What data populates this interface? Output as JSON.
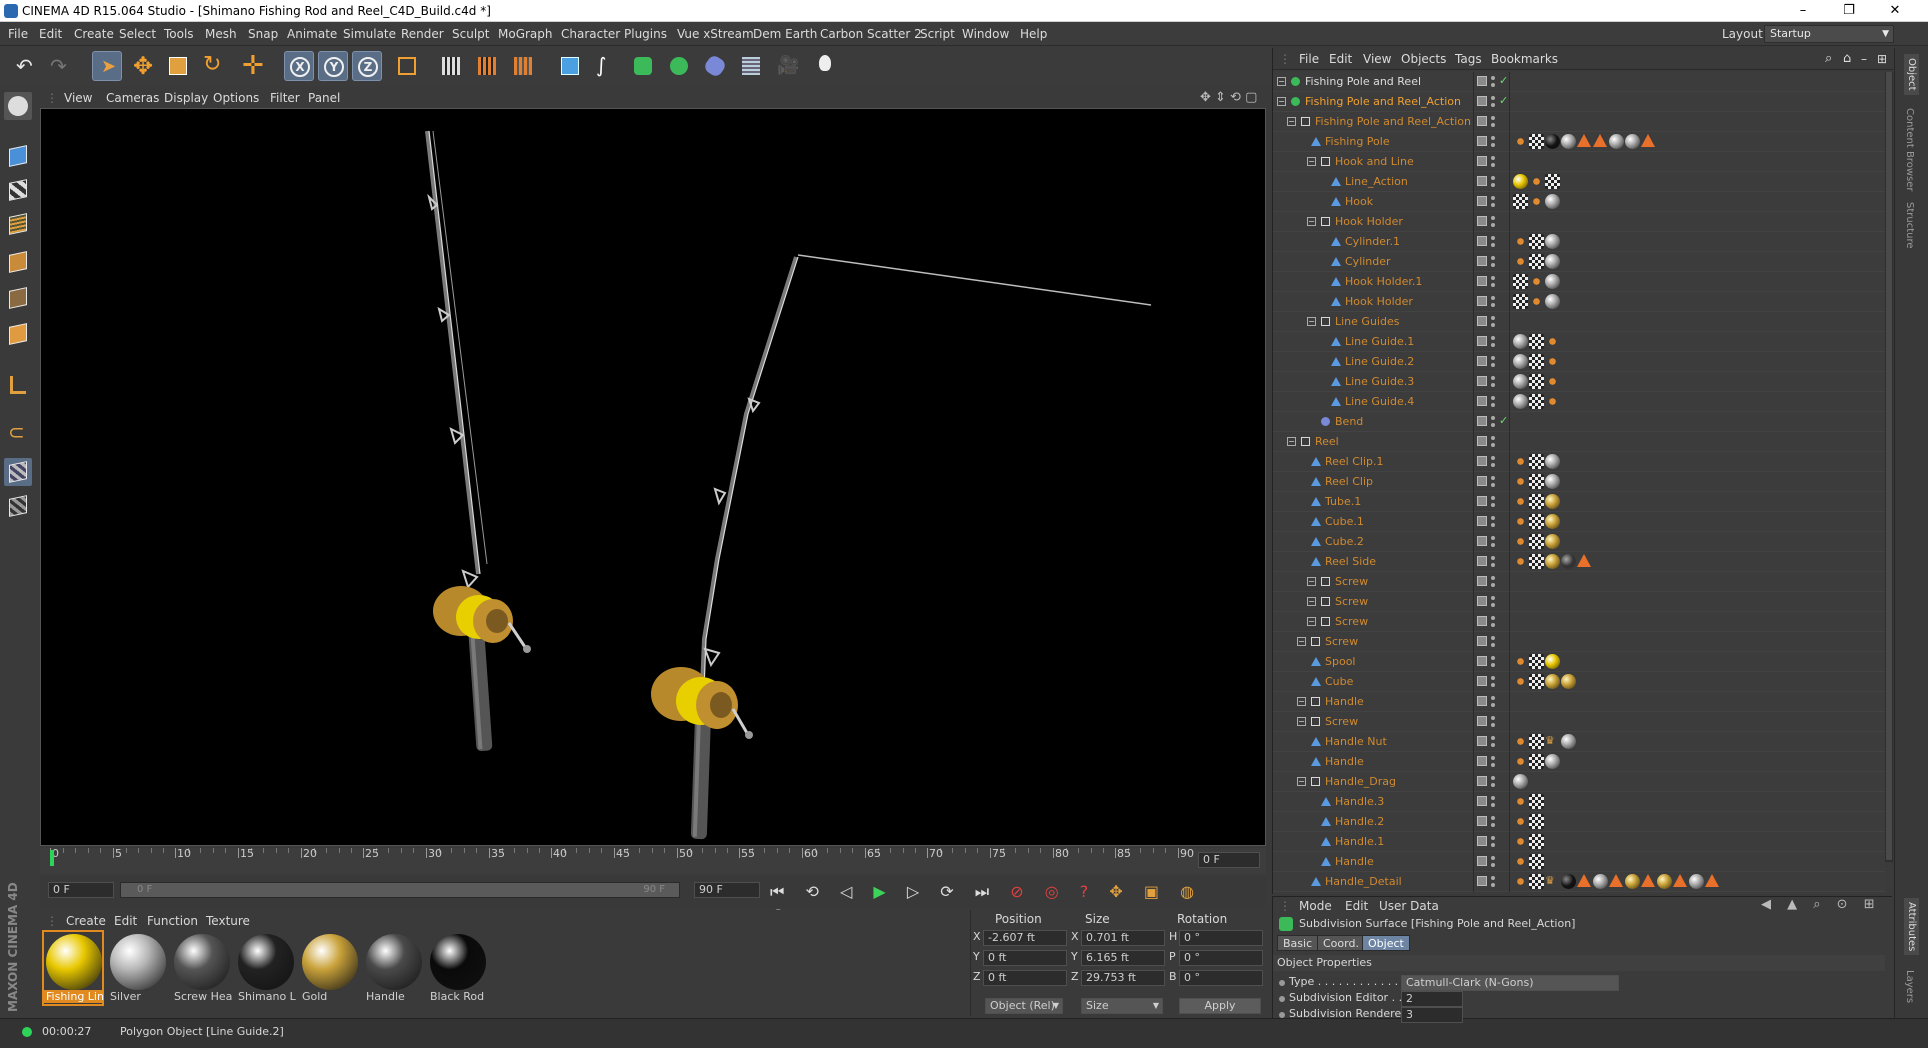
{
  "window": {
    "title": "CINEMA 4D R15.064 Studio - [Shimano Fishing Rod and Reel_C4D_Build.c4d *]",
    "controls": [
      "–",
      "❐",
      "✕"
    ]
  },
  "menubar": {
    "items": [
      "File",
      "Edit",
      "Create",
      "Select",
      "Tools",
      "Mesh",
      "Snap",
      "Animate",
      "Simulate",
      "Render",
      "Sculpt",
      "MoGraph",
      "Character",
      "Plugins",
      "Vue xStream",
      "Dem Earth",
      "Carbon Scatter 2",
      "Script",
      "Window",
      "Help"
    ],
    "layout_label": "Layout:",
    "layout_value": "Startup"
  },
  "toolbar": {
    "axis_x": "X",
    "axis_y": "Y",
    "axis_z": "Z"
  },
  "viewport": {
    "menu": [
      "View",
      "Cameras",
      "Display",
      "Options",
      "Filter",
      "Panel"
    ]
  },
  "timeline": {
    "ticks": [
      "0",
      "5",
      "10",
      "15",
      "20",
      "25",
      "30",
      "35",
      "40",
      "45",
      "50",
      "55",
      "60",
      "65",
      "70",
      "75",
      "80",
      "85",
      "90"
    ],
    "current_frame": "0 F",
    "start_field": "0 F",
    "range_start": "0 F",
    "range_end": "90 F",
    "end_field": "90 F"
  },
  "materials": {
    "menu": [
      "Create",
      "Edit",
      "Function",
      "Texture"
    ],
    "items": [
      {
        "name": "Fishing Lin",
        "color": "#e8c800"
      },
      {
        "name": "Silver",
        "color": "#b8b8b8"
      },
      {
        "name": "Screw Head",
        "color": "#555555"
      },
      {
        "name": "Shimano Lo",
        "color": "#222222"
      },
      {
        "name": "Gold",
        "color": "#c9a23a"
      },
      {
        "name": "Handle",
        "color": "#4a4a4a"
      },
      {
        "name": "Black Rod",
        "color": "#0a0a0a"
      }
    ]
  },
  "coordinates": {
    "headers": [
      "Position",
      "Size",
      "Rotation"
    ],
    "rows": [
      {
        "axis": "X",
        "pos": "-2.607 ft",
        "size_axis": "X",
        "size": "0.701 ft",
        "rot_axis": "H",
        "rot": "0 °"
      },
      {
        "axis": "Y",
        "pos": "0 ft",
        "size_axis": "Y",
        "size": "6.165 ft",
        "rot_axis": "P",
        "rot": "0 °"
      },
      {
        "axis": "Z",
        "pos": "0 ft",
        "size_axis": "Z",
        "size": "29.753 ft",
        "rot_axis": "B",
        "rot": "0 °"
      }
    ],
    "mode": "Object (Rel)",
    "size_mode": "Size",
    "apply": "Apply"
  },
  "status": {
    "time": "00:00:27",
    "message": "Polygon Object [Line Guide.2]"
  },
  "object_manager": {
    "menu": [
      "File",
      "Edit",
      "View",
      "Objects",
      "Tags",
      "Bookmarks"
    ],
    "rows": [
      {
        "name": "Fishing Pole and Reel",
        "depth": 0,
        "color": "#dcdcdc",
        "icon": "sds",
        "check": true
      },
      {
        "name": "Fishing Pole and Reel_Action",
        "depth": 0,
        "color": "#f0a030",
        "icon": "sds",
        "check": true
      },
      {
        "name": "Fishing Pole and Reel_Action",
        "depth": 1,
        "color": "#d08a30",
        "icon": "null"
      },
      {
        "name": "Fishing Pole",
        "depth": 2,
        "color": "#d08a30",
        "icon": "poly",
        "tags": [
          "phong",
          "check",
          "black",
          "silver",
          "tri",
          "tri",
          "silver",
          "silver",
          "tri"
        ]
      },
      {
        "name": "Hook and Line",
        "depth": 3,
        "color": "#d08a30",
        "icon": "null"
      },
      {
        "name": "Line_Action",
        "depth": 4,
        "color": "#d08a30",
        "icon": "poly",
        "tags": [
          "yellow",
          "phong",
          "check"
        ]
      },
      {
        "name": "Hook",
        "depth": 4,
        "color": "#d08a30",
        "icon": "poly",
        "tags": [
          "check",
          "phong",
          "silver"
        ]
      },
      {
        "name": "Hook Holder",
        "depth": 3,
        "color": "#d08a30",
        "icon": "null"
      },
      {
        "name": "Cylinder.1",
        "depth": 4,
        "color": "#d08a30",
        "icon": "poly",
        "tags": [
          "phong",
          "check",
          "silver"
        ]
      },
      {
        "name": "Cylinder",
        "depth": 4,
        "color": "#d08a30",
        "icon": "poly",
        "tags": [
          "phong",
          "check",
          "silver"
        ]
      },
      {
        "name": "Hook Holder.1",
        "depth": 4,
        "color": "#d08a30",
        "icon": "poly",
        "tags": [
          "check",
          "phong",
          "silver"
        ]
      },
      {
        "name": "Hook Holder",
        "depth": 4,
        "color": "#d08a30",
        "icon": "poly",
        "tags": [
          "check",
          "phong",
          "silver"
        ]
      },
      {
        "name": "Line Guides",
        "depth": 3,
        "color": "#d08a30",
        "icon": "null"
      },
      {
        "name": "Line Guide.1",
        "depth": 4,
        "color": "#d08a30",
        "icon": "poly",
        "tags": [
          "silver",
          "check",
          "phong"
        ]
      },
      {
        "name": "Line Guide.2",
        "depth": 4,
        "color": "#d08a30",
        "icon": "poly",
        "tags": [
          "silver",
          "check",
          "phong"
        ]
      },
      {
        "name": "Line Guide.3",
        "depth": 4,
        "color": "#d08a30",
        "icon": "poly",
        "tags": [
          "silver",
          "check",
          "phong"
        ]
      },
      {
        "name": "Line Guide.4",
        "depth": 4,
        "color": "#d08a30",
        "icon": "poly",
        "tags": [
          "silver",
          "check",
          "phong"
        ]
      },
      {
        "name": "Bend",
        "depth": 3,
        "color": "#d08a30",
        "icon": "deform",
        "check": true
      },
      {
        "name": "Reel",
        "depth": 1,
        "color": "#d08a30",
        "icon": "null"
      },
      {
        "name": "Reel Clip.1",
        "depth": 2,
        "color": "#d08a30",
        "icon": "poly",
        "tags": [
          "phong",
          "check",
          "silver"
        ]
      },
      {
        "name": "Reel Clip",
        "depth": 2,
        "color": "#d08a30",
        "icon": "poly",
        "tags": [
          "phong",
          "check",
          "silver"
        ]
      },
      {
        "name": "Tube.1",
        "depth": 2,
        "color": "#d08a30",
        "icon": "poly",
        "tags": [
          "phong",
          "check",
          "gold"
        ]
      },
      {
        "name": "Cube.1",
        "depth": 2,
        "color": "#d08a30",
        "icon": "poly",
        "tags": [
          "phong",
          "check",
          "gold"
        ]
      },
      {
        "name": "Cube.2",
        "depth": 2,
        "color": "#d08a30",
        "icon": "poly",
        "tags": [
          "phong",
          "check",
          "gold"
        ]
      },
      {
        "name": "Reel Side",
        "depth": 2,
        "color": "#d08a30",
        "icon": "poly",
        "tags": [
          "phong",
          "check",
          "gold",
          "dark",
          "tri"
        ]
      },
      {
        "name": "Screw",
        "depth": 3,
        "color": "#d08a30",
        "icon": "null"
      },
      {
        "name": "Screw",
        "depth": 3,
        "color": "#d08a30",
        "icon": "null"
      },
      {
        "name": "Screw",
        "depth": 3,
        "color": "#d08a30",
        "icon": "null"
      },
      {
        "name": "Screw",
        "depth": 2,
        "color": "#d08a30",
        "icon": "null"
      },
      {
        "name": "Spool",
        "depth": 2,
        "color": "#d08a30",
        "icon": "poly",
        "tags": [
          "phong",
          "check",
          "yellow"
        ]
      },
      {
        "name": "Cube",
        "depth": 2,
        "color": "#d08a30",
        "icon": "poly",
        "tags": [
          "phong",
          "check",
          "gold",
          "gold"
        ]
      },
      {
        "name": "Handle",
        "depth": 2,
        "color": "#d08a30",
        "icon": "null"
      },
      {
        "name": "Screw",
        "depth": 2,
        "color": "#d08a30",
        "icon": "null"
      },
      {
        "name": "Handle Nut",
        "depth": 2,
        "color": "#d08a30",
        "icon": "poly",
        "tags": [
          "phong",
          "check",
          "crown",
          "silver"
        ]
      },
      {
        "name": "Handle",
        "depth": 2,
        "color": "#d08a30",
        "icon": "poly",
        "tags": [
          "phong",
          "check",
          "silver"
        ]
      },
      {
        "name": "Handle_Drag",
        "depth": 2,
        "color": "#d08a30",
        "icon": "null",
        "tags": [
          "silver"
        ]
      },
      {
        "name": "Handle.3",
        "depth": 3,
        "color": "#d08a30",
        "icon": "poly",
        "tags": [
          "phong",
          "check"
        ]
      },
      {
        "name": "Handle.2",
        "depth": 3,
        "color": "#d08a30",
        "icon": "poly",
        "tags": [
          "phong",
          "check"
        ]
      },
      {
        "name": "Handle.1",
        "depth": 3,
        "color": "#d08a30",
        "icon": "poly",
        "tags": [
          "phong",
          "check"
        ]
      },
      {
        "name": "Handle",
        "depth": 3,
        "color": "#d08a30",
        "icon": "poly",
        "tags": [
          "phong",
          "check"
        ]
      },
      {
        "name": "Handle_Detail",
        "depth": 2,
        "color": "#d08a30",
        "icon": "poly",
        "tags": [
          "phong",
          "check",
          "crown",
          "black",
          "tri",
          "silver",
          "tri",
          "gold",
          "tri",
          "gold",
          "tri",
          "silver",
          "tri"
        ]
      }
    ]
  },
  "attribute_manager": {
    "menu": [
      "Mode",
      "Edit",
      "User Data"
    ],
    "title": "Subdivision Surface [Fishing Pole and Reel_Action]",
    "tabs": [
      "Basic",
      "Coord.",
      "Object"
    ],
    "section": "Object Properties",
    "props": [
      {
        "label": "Type . . . . . . . . . . . . .",
        "value": "Catmull-Clark (N-Gons)"
      },
      {
        "label": "Subdivision Editor . .",
        "value": "2"
      },
      {
        "label": "Subdivision Renderer",
        "value": "3"
      }
    ]
  },
  "right_strip": {
    "tabs": [
      "Object",
      "Content Browser",
      "Structure",
      "Attributes",
      "Layers"
    ]
  },
  "brand": "MAXON CINEMA 4D"
}
